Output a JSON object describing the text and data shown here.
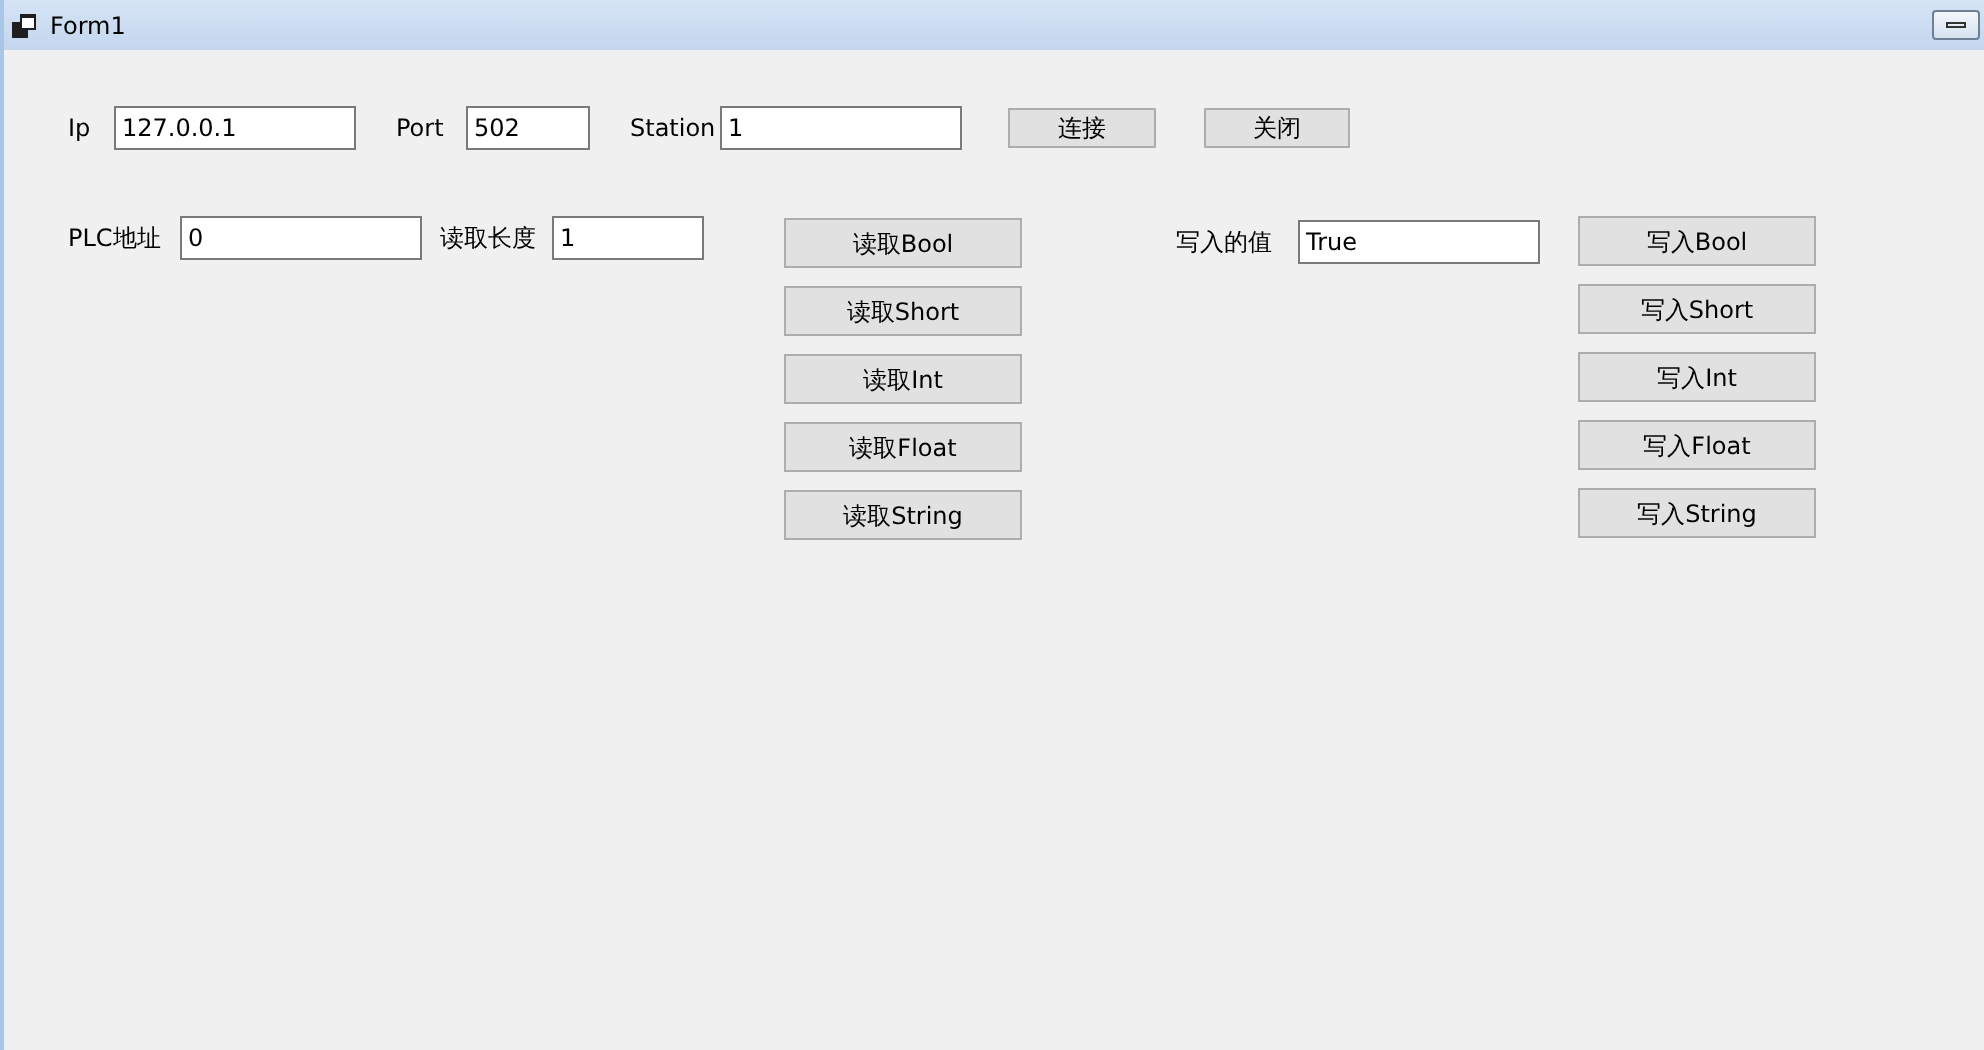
{
  "window": {
    "title": "Form1"
  },
  "connection": {
    "fields": [
      {
        "label": "Ip",
        "value": "127.0.0.1"
      },
      {
        "label": "Port",
        "value": "502"
      },
      {
        "label": "Station",
        "value": "1"
      }
    ],
    "buttons": [
      "连接",
      "关闭"
    ]
  },
  "read": {
    "fields": [
      {
        "label": "PLC地址",
        "value": "0"
      },
      {
        "label": "读取长度",
        "value": "1"
      }
    ],
    "buttons": [
      "读取Bool",
      "读取Short",
      "读取Int",
      "读取Float",
      "读取String"
    ]
  },
  "write": {
    "field": {
      "label": "写入的值",
      "value": "True"
    },
    "buttons": [
      "写入Bool",
      "写入Short",
      "写入Int",
      "写入Float",
      "写入String"
    ]
  }
}
